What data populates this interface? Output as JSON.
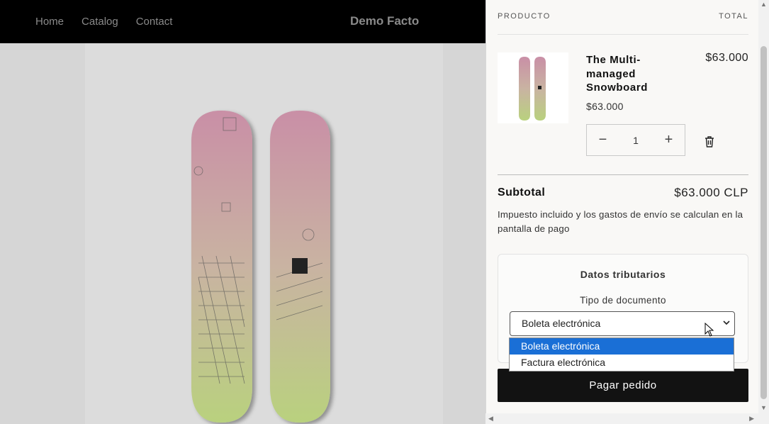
{
  "header": {
    "nav": [
      "Home",
      "Catalog",
      "Contact"
    ],
    "brand": "Demo Facto"
  },
  "cart": {
    "col_product": "PRODUCTO",
    "col_total": "TOTAL",
    "item": {
      "title": "The Multi-managed Snowboard",
      "price": "$63.000",
      "line_total": "$63.000",
      "quantity": "1"
    },
    "subtotal_label": "Subtotal",
    "subtotal_value": "$63.000 CLP",
    "tax_note": "Impuesto incluido y los gastos de envío se calculan en la pantalla de pago",
    "tax_card": {
      "title": "Datos tributarios",
      "doc_type_label": "Tipo de documento",
      "selected": "Boleta electrónica",
      "options": [
        "Boleta electrónica",
        "Factura electrónica"
      ]
    },
    "checkout_label": "Pagar pedido"
  },
  "colors": {
    "header_bg": "#000000",
    "accent_selected": "#1a6fd6",
    "checkout_bg": "#121212"
  }
}
